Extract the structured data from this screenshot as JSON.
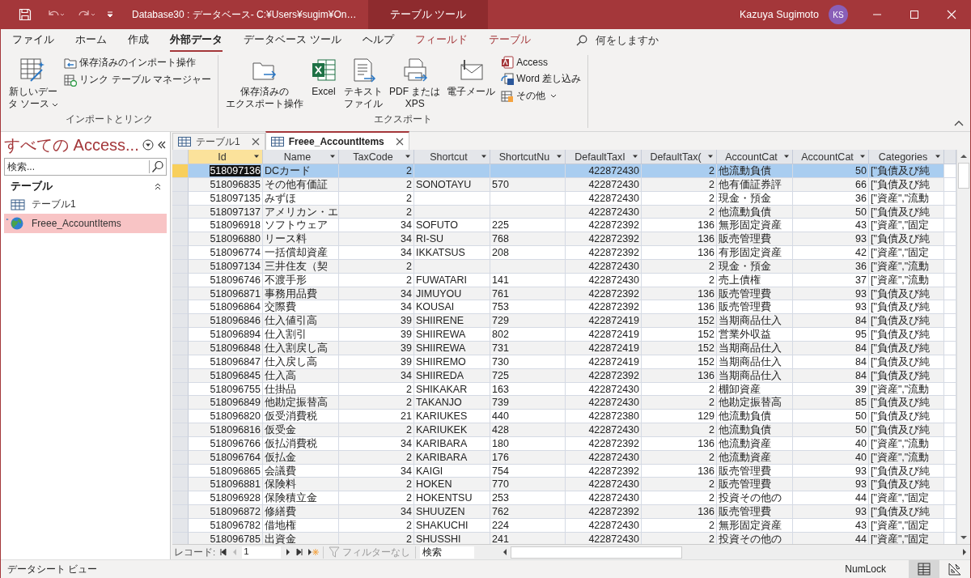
{
  "title_bar": {
    "title": "Database30 : データベース- C:¥Users¥sugim¥On…",
    "context_label": "テーブル ツール",
    "user": "Kazuya Sugimoto",
    "avatar": "KS"
  },
  "ribbon_tabs": [
    {
      "label": "ファイル",
      "selected": false,
      "kind": "normal"
    },
    {
      "label": "ホーム",
      "selected": false,
      "kind": "normal"
    },
    {
      "label": "作成",
      "selected": false,
      "kind": "normal"
    },
    {
      "label": "外部データ",
      "selected": true,
      "kind": "normal"
    },
    {
      "label": "データベース ツール",
      "selected": false,
      "kind": "normal"
    },
    {
      "label": "ヘルプ",
      "selected": false,
      "kind": "normal"
    },
    {
      "label": "フィールド",
      "selected": false,
      "kind": "contextual"
    },
    {
      "label": "テーブル",
      "selected": false,
      "kind": "contextual"
    }
  ],
  "tell_me": {
    "placeholder": "何をしますか"
  },
  "ribbon_groups": [
    {
      "label": "インポートとリンク",
      "large_buttons": [
        {
          "lines": [
            "新しいデー",
            "タ ソース"
          ],
          "dropdown": true
        }
      ],
      "small_buttons": [
        {
          "label": "保存済みのインポート操作",
          "dropdown": false
        },
        {
          "label": "リンク テーブル マネージャー",
          "dropdown": false
        }
      ]
    },
    {
      "label": "エクスポート",
      "large_buttons": [
        {
          "lines": [
            "保存済みの",
            "エクスポート操作"
          ],
          "dropdown": false
        },
        {
          "lines": [
            "Excel"
          ],
          "dropdown": false
        },
        {
          "lines": [
            "テキスト",
            "ファイル"
          ],
          "dropdown": false
        },
        {
          "lines": [
            "PDF または",
            "XPS"
          ],
          "dropdown": false
        },
        {
          "lines": [
            "電子メール"
          ],
          "dropdown": false
        }
      ],
      "small_buttons": [
        {
          "label": "Access",
          "dropdown": false
        },
        {
          "label": "Word 差し込み",
          "dropdown": false
        },
        {
          "label": "その他",
          "dropdown": true
        }
      ]
    }
  ],
  "nav_pane": {
    "title": "すべての Access...",
    "search": {
      "placeholder": "検索..."
    },
    "groups": [
      {
        "label": "テーブル",
        "expanded": true,
        "items": [
          {
            "label": "テーブル1",
            "kind": "local",
            "selected": false
          },
          {
            "label": "Freee_AccountItems",
            "kind": "linked",
            "selected": true
          }
        ]
      }
    ]
  },
  "doc_tabs": [
    {
      "label": "テーブル1",
      "selected": false
    },
    {
      "label": "Freee_AccountItems",
      "selected": true
    }
  ],
  "table": {
    "columns": [
      {
        "label": "Id",
        "kind": "number",
        "current": true
      },
      {
        "label": "Name",
        "kind": "text",
        "current": false
      },
      {
        "label": "TaxCode",
        "kind": "number",
        "current": false
      },
      {
        "label": "Shortcut",
        "kind": "text",
        "current": false
      },
      {
        "label": "ShortcutNu",
        "kind": "text",
        "current": false
      },
      {
        "label": "DefaultTaxI",
        "kind": "number",
        "current": false
      },
      {
        "label": "DefaultTax(",
        "kind": "number",
        "current": false
      },
      {
        "label": "AccountCat",
        "kind": "text",
        "current": false
      },
      {
        "label": "AccountCat",
        "kind": "number",
        "current": false
      },
      {
        "label": "Categories",
        "kind": "text",
        "current": false
      }
    ],
    "rows": [
      {
        "selected": true,
        "cells": [
          "518097136",
          "DCカード",
          "2",
          "",
          "",
          "422872430",
          "2",
          "他流動負債",
          "50",
          "[\"負債及び純"
        ]
      },
      {
        "selected": false,
        "cells": [
          "518096835",
          "その他有価証",
          "2",
          "SONOTAYU",
          "570",
          "422872430",
          "2",
          "他有価証券評",
          "66",
          "[\"負債及び純"
        ]
      },
      {
        "selected": false,
        "cells": [
          "518097135",
          "みずほ",
          "2",
          "",
          "",
          "422872430",
          "2",
          "現金・預金",
          "36",
          "[\"資産\",\"流動"
        ]
      },
      {
        "selected": false,
        "cells": [
          "518097137",
          "アメリカン・エ",
          "2",
          "",
          "",
          "422872430",
          "2",
          "他流動負債",
          "50",
          "[\"負債及び純"
        ]
      },
      {
        "selected": false,
        "cells": [
          "518096918",
          "ソフトウェア",
          "34",
          "SOFUTO",
          "225",
          "422872392",
          "136",
          "無形固定資産",
          "43",
          "[\"資産\",\"固定"
        ]
      },
      {
        "selected": false,
        "cells": [
          "518096880",
          "リース料",
          "34",
          "RI-SU",
          "768",
          "422872392",
          "136",
          "販売管理費",
          "93",
          "[\"負債及び純"
        ]
      },
      {
        "selected": false,
        "cells": [
          "518096774",
          "一括償却資産",
          "34",
          "IKKATSUS",
          "208",
          "422872392",
          "136",
          "有形固定資産",
          "42",
          "[\"資産\",\"固定"
        ]
      },
      {
        "selected": false,
        "cells": [
          "518097134",
          "三井住友（契",
          "2",
          "",
          "",
          "422872430",
          "2",
          "現金・預金",
          "36",
          "[\"資産\",\"流動"
        ]
      },
      {
        "selected": false,
        "cells": [
          "518096746",
          "不渡手形",
          "2",
          "FUWATARI",
          "141",
          "422872430",
          "2",
          "売上債権",
          "37",
          "[\"資産\",\"流動"
        ]
      },
      {
        "selected": false,
        "cells": [
          "518096871",
          "事務用品費",
          "34",
          "JIMUYOU",
          "761",
          "422872392",
          "136",
          "販売管理費",
          "93",
          "[\"負債及び純"
        ]
      },
      {
        "selected": false,
        "cells": [
          "518096864",
          "交際費",
          "34",
          "KOUSAI",
          "753",
          "422872392",
          "136",
          "販売管理費",
          "93",
          "[\"負債及び純"
        ]
      },
      {
        "selected": false,
        "cells": [
          "518096846",
          "仕入値引高",
          "39",
          "SHIIRENE",
          "729",
          "422872419",
          "152",
          "当期商品仕入",
          "84",
          "[\"負債及び純"
        ]
      },
      {
        "selected": false,
        "cells": [
          "518096894",
          "仕入割引",
          "39",
          "SHIIREWA",
          "802",
          "422872419",
          "152",
          "営業外収益",
          "95",
          "[\"負債及び純"
        ]
      },
      {
        "selected": false,
        "cells": [
          "518096848",
          "仕入割戻し高",
          "39",
          "SHIIREWA",
          "731",
          "422872419",
          "152",
          "当期商品仕入",
          "84",
          "[\"負債及び純"
        ]
      },
      {
        "selected": false,
        "cells": [
          "518096847",
          "仕入戻し高",
          "39",
          "SHIIREMO",
          "730",
          "422872419",
          "152",
          "当期商品仕入",
          "84",
          "[\"負債及び純"
        ]
      },
      {
        "selected": false,
        "cells": [
          "518096845",
          "仕入高",
          "34",
          "SHIIREDA",
          "725",
          "422872392",
          "136",
          "当期商品仕入",
          "84",
          "[\"負債及び純"
        ]
      },
      {
        "selected": false,
        "cells": [
          "518096755",
          "仕掛品",
          "2",
          "SHIKAKAR",
          "163",
          "422872430",
          "2",
          "棚卸資産",
          "39",
          "[\"資産\",\"流動"
        ]
      },
      {
        "selected": false,
        "cells": [
          "518096849",
          "他勘定振替高",
          "2",
          "TAKANJO",
          "739",
          "422872430",
          "2",
          "他勘定振替高",
          "85",
          "[\"負債及び純"
        ]
      },
      {
        "selected": false,
        "cells": [
          "518096820",
          "仮受消費税",
          "21",
          "KARIUKES",
          "440",
          "422872380",
          "129",
          "他流動負債",
          "50",
          "[\"負債及び純"
        ]
      },
      {
        "selected": false,
        "cells": [
          "518096816",
          "仮受金",
          "2",
          "KARIUKEK",
          "428",
          "422872430",
          "2",
          "他流動負債",
          "50",
          "[\"負債及び純"
        ]
      },
      {
        "selected": false,
        "cells": [
          "518096766",
          "仮払消費税",
          "34",
          "KARIBARA",
          "180",
          "422872392",
          "136",
          "他流動資産",
          "40",
          "[\"資産\",\"流動"
        ]
      },
      {
        "selected": false,
        "cells": [
          "518096764",
          "仮払金",
          "2",
          "KARIBARA",
          "176",
          "422872430",
          "2",
          "他流動資産",
          "40",
          "[\"資産\",\"流動"
        ]
      },
      {
        "selected": false,
        "cells": [
          "518096865",
          "会議費",
          "34",
          "KAIGI",
          "754",
          "422872392",
          "136",
          "販売管理費",
          "93",
          "[\"負債及び純"
        ]
      },
      {
        "selected": false,
        "cells": [
          "518096881",
          "保険料",
          "2",
          "HOKEN",
          "770",
          "422872430",
          "2",
          "販売管理費",
          "93",
          "[\"負債及び純"
        ]
      },
      {
        "selected": false,
        "cells": [
          "518096928",
          "保険積立金",
          "2",
          "HOKENTSU",
          "253",
          "422872430",
          "2",
          "投資その他の",
          "44",
          "[\"資産\",\"固定"
        ]
      },
      {
        "selected": false,
        "cells": [
          "518096872",
          "修繕費",
          "34",
          "SHUUZEN",
          "762",
          "422872392",
          "136",
          "販売管理費",
          "93",
          "[\"負債及び純"
        ]
      },
      {
        "selected": false,
        "cells": [
          "518096782",
          "借地権",
          "2",
          "SHAKUCHI",
          "224",
          "422872430",
          "2",
          "無形固定資産",
          "43",
          "[\"資産\",\"固定"
        ]
      },
      {
        "selected": false,
        "cells": [
          "518096785",
          "出資金",
          "2",
          "SHUSSHI",
          "241",
          "422872430",
          "2",
          "投資その他の",
          "44",
          "[\"資産\",\"固定"
        ]
      }
    ]
  },
  "record_nav": {
    "label": "レコード:",
    "current": "1",
    "filter": {
      "label": "フィルターなし",
      "disabled": true
    },
    "search": {
      "placeholder": "検索"
    }
  },
  "status_bar": {
    "view": "データシート ビュー",
    "indicators": [
      "NumLock"
    ],
    "view_buttons": [
      {
        "selected": true
      },
      {
        "selected": false
      }
    ]
  }
}
